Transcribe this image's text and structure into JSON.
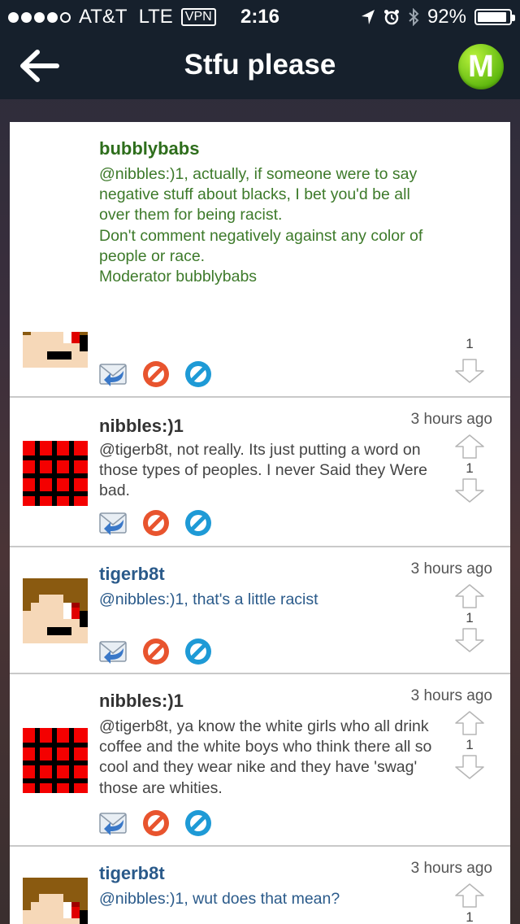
{
  "status_bar": {
    "carrier": "AT&T",
    "network": "LTE",
    "vpn": "VPN",
    "time": "2:16",
    "battery": "92%",
    "battery_level": 0.92
  },
  "nav": {
    "title": "Stfu please",
    "logo_letter": "M"
  },
  "colors": {
    "moderator_green": "#2e6e1c",
    "user_blue": "#2a5a8a",
    "regular_text": "#444444",
    "bar": "#16202c"
  },
  "posts": [
    {
      "author": "bubblybabs",
      "time": "",
      "text": "@nibbles:)1, actually, if someone were to say negative stuff about blacks, I bet you'd be all over them for being racist.\nDon't comment negatively against any color of people or race.\nModerator bubblybabs",
      "score": "1",
      "avatar": "red-eye-avatar"
    },
    {
      "author": "nibbles:)1",
      "time": "3 hours ago",
      "text": "@tigerb8t, not really. Its just putting a word on those types of peoples. I never Said they Were bad.",
      "score": "1",
      "avatar": "red-grid-avatar"
    },
    {
      "author": "tigerb8t",
      "time": "3 hours ago",
      "text": "@nibbles:)1, that's a little racist",
      "score": "1",
      "avatar": "red-eye-avatar"
    },
    {
      "author": "nibbles:)1",
      "time": "3 hours ago",
      "text": "@tigerb8t, ya know the white girls who all drink coffee and the white boys who think there all so cool and they wear nike and they have 'swag' those are whities.",
      "score": "1",
      "avatar": "red-grid-avatar"
    },
    {
      "author": "tigerb8t",
      "time": "3 hours ago",
      "text": "@nibbles:)1, wut does that mean?",
      "score": "1",
      "avatar": "red-eye-avatar"
    }
  ]
}
